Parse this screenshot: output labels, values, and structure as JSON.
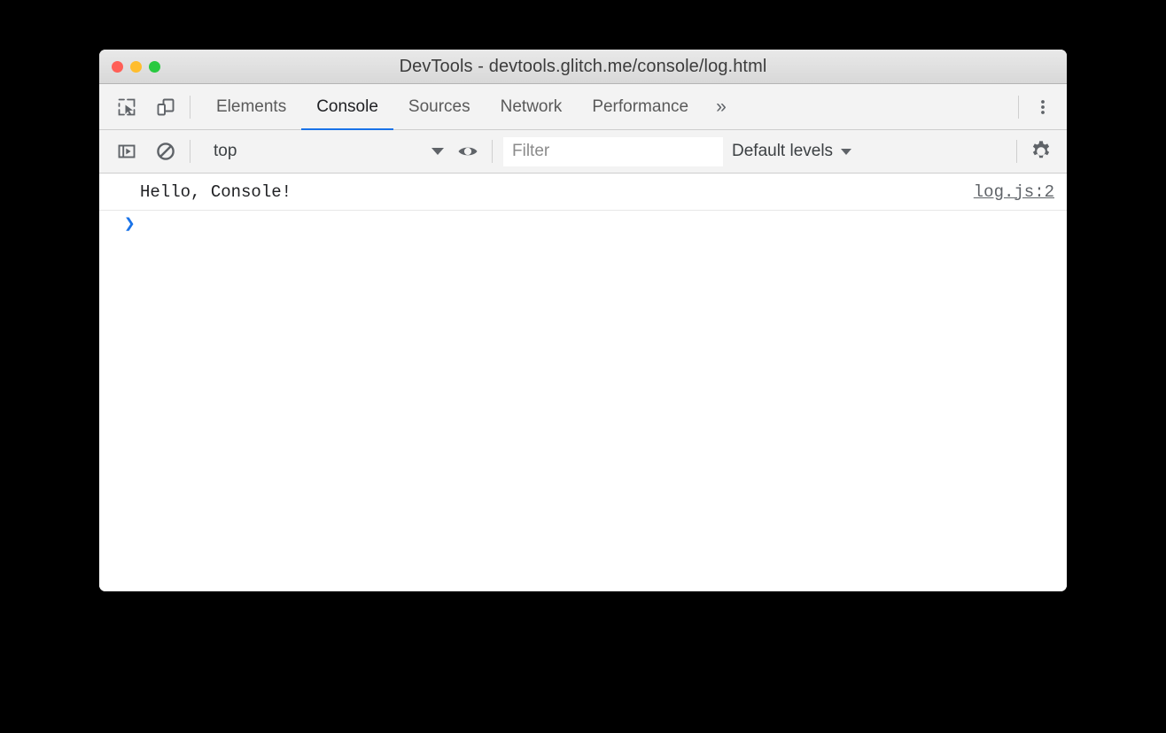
{
  "window": {
    "title": "DevTools - devtools.glitch.me/console/log.html",
    "traffic_lights": [
      {
        "name": "close",
        "color": "#ff5f57"
      },
      {
        "name": "minimize",
        "color": "#ffbd2e"
      },
      {
        "name": "zoom",
        "color": "#28c940"
      }
    ]
  },
  "tabbar": {
    "icons": [
      {
        "name": "inspect-element-icon",
        "title": "Inspect"
      },
      {
        "name": "device-toolbar-icon",
        "title": "Toggle device toolbar"
      }
    ],
    "tabs": [
      {
        "label": "Elements",
        "active": false
      },
      {
        "label": "Console",
        "active": true
      },
      {
        "label": "Sources",
        "active": false
      },
      {
        "label": "Network",
        "active": false
      },
      {
        "label": "Performance",
        "active": false
      }
    ],
    "more_tabs_label": "»",
    "menu_icon": "kebab-menu-icon",
    "active_tab_underline_color": "#1a73e8"
  },
  "console_toolbar": {
    "sidebar_icon": "console-sidebar-icon",
    "clear_icon": "clear-console-icon",
    "context": {
      "value": "top",
      "caret": "▼"
    },
    "live_expression_icon": "eye-icon",
    "filter": {
      "value": "",
      "placeholder": "Filter"
    },
    "levels": {
      "label": "Default levels",
      "caret": "▼"
    },
    "settings_icon": "gear-icon"
  },
  "console": {
    "messages": [
      {
        "text": "Hello, Console!",
        "source": "log.js:2"
      }
    ],
    "prompt": {
      "chevron": "❯",
      "value": ""
    }
  }
}
